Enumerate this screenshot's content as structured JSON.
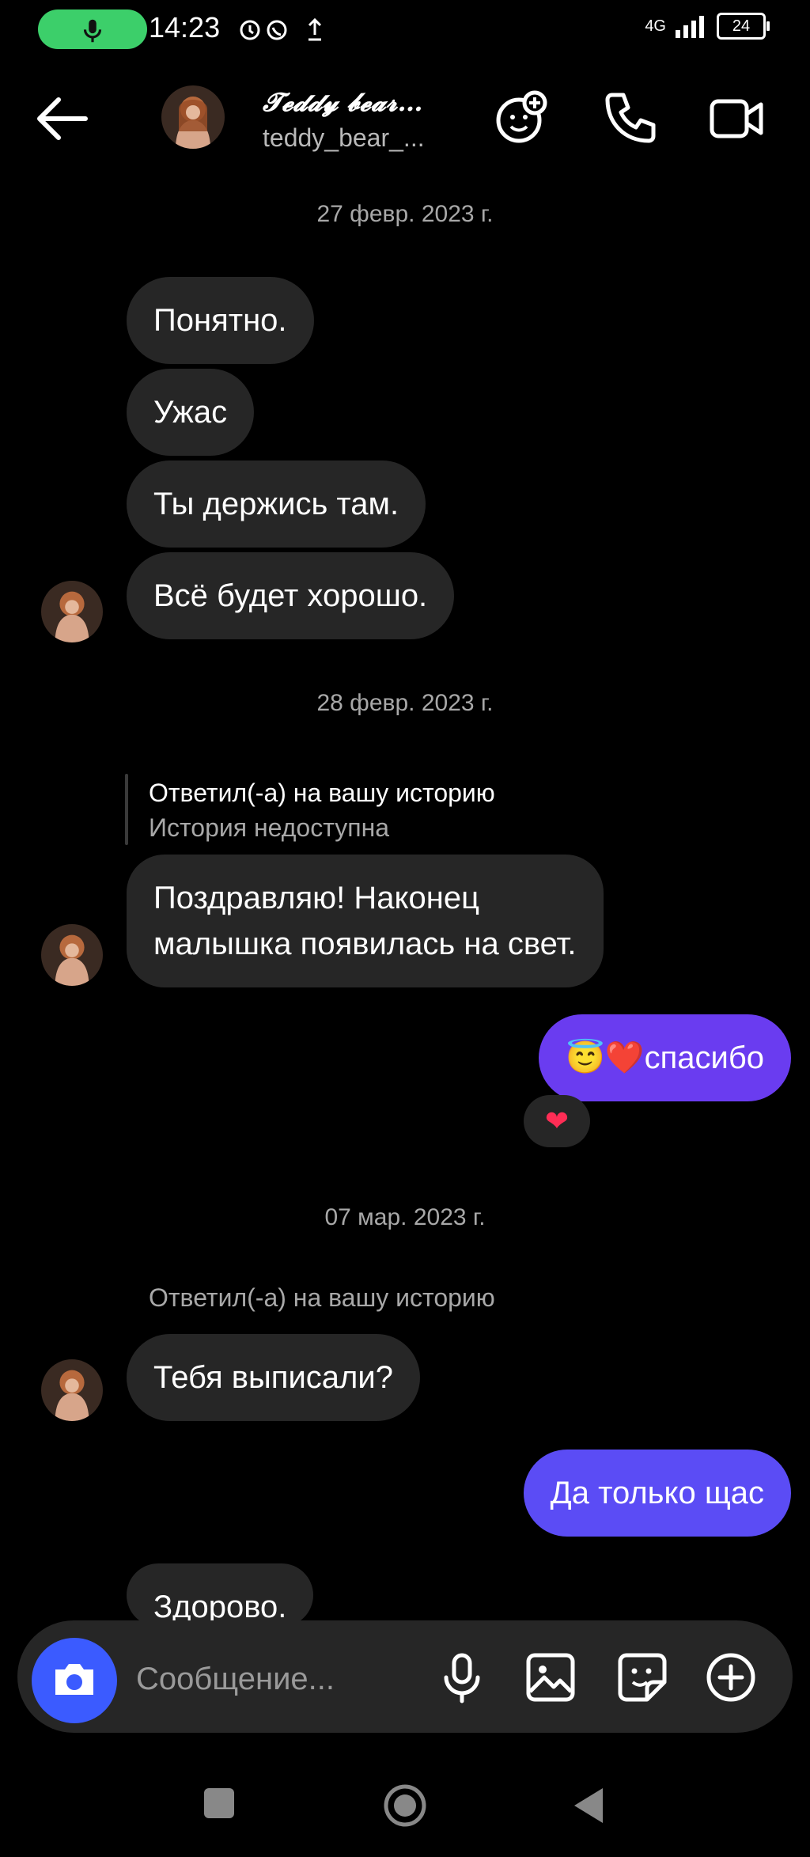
{
  "status_bar": {
    "time": "14:23",
    "network": "4G",
    "battery": "24"
  },
  "header": {
    "name": "𝓣𝓮𝓭𝓭𝔂 𝓫𝓮𝓪𝓻…",
    "username": "teddy_bear_..."
  },
  "chat": {
    "dates": [
      "27 февр. 2023 г.",
      "28 февр. 2023 г.",
      "07 мар. 2023 г."
    ],
    "messages": [
      {
        "from": "them",
        "text": "Понятно."
      },
      {
        "from": "them",
        "text": "Ужас"
      },
      {
        "from": "them",
        "text": "Ты держись там."
      },
      {
        "from": "them",
        "text": "Всё будет хорошо."
      },
      {
        "from": "them",
        "reply_title": "Ответил(-а) на вашу историю",
        "reply_sub": "История недоступна",
        "line1": "Поздравляю! Наконец",
        "line2": "малышка появилась на свет."
      },
      {
        "from": "me",
        "text": "😇❤️спасибо",
        "reaction": "❤"
      },
      {
        "from": "them",
        "reply_title": "Ответил(-а) на вашу историю",
        "text": "Тебя выписали?"
      },
      {
        "from": "me",
        "text": "Да только щас"
      },
      {
        "from": "them",
        "text": "Здорово."
      }
    ]
  },
  "composer": {
    "placeholder": "Сообщение..."
  },
  "colors": {
    "background": "#000000",
    "bubble_them": "#262626",
    "bubble_me": "#6a3cf0",
    "camera_button": "#3b5bff",
    "mic_pill": "#3ccf6a"
  }
}
